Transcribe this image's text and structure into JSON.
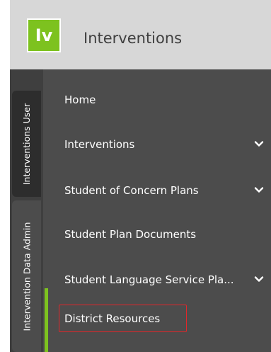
{
  "header": {
    "logo_text": "Iv",
    "title": "Interventions"
  },
  "tabs": [
    {
      "label": "Interventions User"
    },
    {
      "label": "Intervention Data Admin"
    }
  ],
  "menu": {
    "items": [
      {
        "label": "Home",
        "has_chevron": false
      },
      {
        "label": "Interventions",
        "has_chevron": true
      },
      {
        "label": "Student of Concern Plans",
        "has_chevron": true
      },
      {
        "label": "Student Plan Documents",
        "has_chevron": false
      },
      {
        "label": "Student Language Service Pla...",
        "has_chevron": true
      },
      {
        "label": "District Resources",
        "has_chevron": false,
        "selected": true
      }
    ]
  },
  "colors": {
    "brand_green": "#7dc21f",
    "menu_bg": "#4c4c4c",
    "header_bg": "#d7d7d7",
    "highlight_red": "#e2262a"
  }
}
